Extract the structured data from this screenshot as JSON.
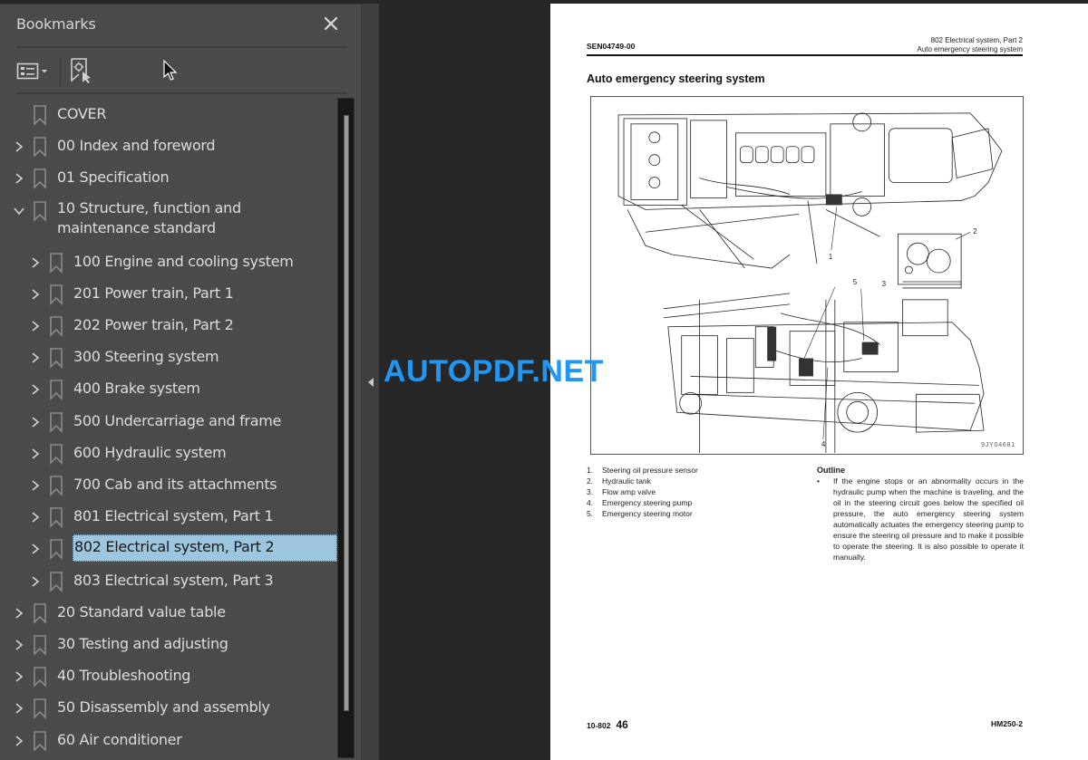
{
  "sidebar": {
    "title": "Bookmarks",
    "close_icon": "close-icon",
    "toolbar": {
      "options_icon": "list-options-icon",
      "find_icon": "find-current-bookmark-icon"
    },
    "items": [
      {
        "label": "COVER",
        "level": 0,
        "expandable": false,
        "expanded": false,
        "selected": false
      },
      {
        "label": "00 Index and foreword",
        "level": 0,
        "expandable": true,
        "expanded": false,
        "selected": false
      },
      {
        "label": "01 Specification",
        "level": 0,
        "expandable": true,
        "expanded": false,
        "selected": false
      },
      {
        "label": "10 Structure, function and maintenance standard",
        "level": 0,
        "expandable": true,
        "expanded": true,
        "selected": false
      },
      {
        "label": "100 Engine and cooling system",
        "level": 1,
        "expandable": true,
        "expanded": false,
        "selected": false
      },
      {
        "label": "201 Power train, Part 1",
        "level": 1,
        "expandable": true,
        "expanded": false,
        "selected": false
      },
      {
        "label": "202 Power train, Part 2",
        "level": 1,
        "expandable": true,
        "expanded": false,
        "selected": false
      },
      {
        "label": "300 Steering system",
        "level": 1,
        "expandable": true,
        "expanded": false,
        "selected": false
      },
      {
        "label": "400 Brake system",
        "level": 1,
        "expandable": true,
        "expanded": false,
        "selected": false
      },
      {
        "label": "500 Undercarriage and frame",
        "level": 1,
        "expandable": true,
        "expanded": false,
        "selected": false
      },
      {
        "label": "600 Hydraulic system",
        "level": 1,
        "expandable": true,
        "expanded": false,
        "selected": false
      },
      {
        "label": "700 Cab and its attachments",
        "level": 1,
        "expandable": true,
        "expanded": false,
        "selected": false
      },
      {
        "label": "801 Electrical system, Part 1",
        "level": 1,
        "expandable": true,
        "expanded": false,
        "selected": false
      },
      {
        "label": "802 Electrical system, Part 2",
        "level": 1,
        "expandable": true,
        "expanded": false,
        "selected": true
      },
      {
        "label": "803 Electrical system, Part 3",
        "level": 1,
        "expandable": true,
        "expanded": false,
        "selected": false
      },
      {
        "label": "20 Standard value table",
        "level": 0,
        "expandable": true,
        "expanded": false,
        "selected": false
      },
      {
        "label": "30 Testing and adjusting",
        "level": 0,
        "expandable": true,
        "expanded": false,
        "selected": false
      },
      {
        "label": "40 Troubleshooting",
        "level": 0,
        "expandable": true,
        "expanded": false,
        "selected": false
      },
      {
        "label": "50 Disassembly and assembly",
        "level": 0,
        "expandable": true,
        "expanded": false,
        "selected": false
      },
      {
        "label": "60 Air conditioner",
        "level": 0,
        "expandable": true,
        "expanded": false,
        "selected": false
      }
    ]
  },
  "document": {
    "doc_code": "SEN04749-00",
    "header_line1": "802 Electrical system, Part 2",
    "header_line2": "Auto emergency steering system",
    "title": "Auto emergency steering system",
    "figure_code": "9JY04681",
    "callouts": [
      "1",
      "2",
      "3",
      "4",
      "5"
    ],
    "legend": [
      {
        "num": "1.",
        "text": "Steering oil pressure sensor"
      },
      {
        "num": "2.",
        "text": "Hydraulic tank"
      },
      {
        "num": "3.",
        "text": "Flow amp valve"
      },
      {
        "num": "4.",
        "text": "Emergency steering pump"
      },
      {
        "num": "5.",
        "text": "Emergency steering motor"
      }
    ],
    "outline_heading": "Outline",
    "outline_bullet": "•",
    "outline_text": "If the engine stops or an abnormality occurs in the hydraulic pump when the machine is traveling, and the oil in the steering circuit goes below the specified oil pressure, the auto emergency steering system automatically actuates the emergency steering pump to ensure the steering oil pressure and to make it possible to operate the steering. It is also possible to operate it manually.",
    "footer_section": "10-802",
    "footer_page": "46",
    "footer_model": "HM250-2"
  },
  "watermark": "AUTOPDF.NET",
  "colors": {
    "selection": "#9cc5e0",
    "watermark": "#2196f3",
    "sidebar_bg": "#4b4b4b",
    "viewer_bg": "#272727"
  }
}
